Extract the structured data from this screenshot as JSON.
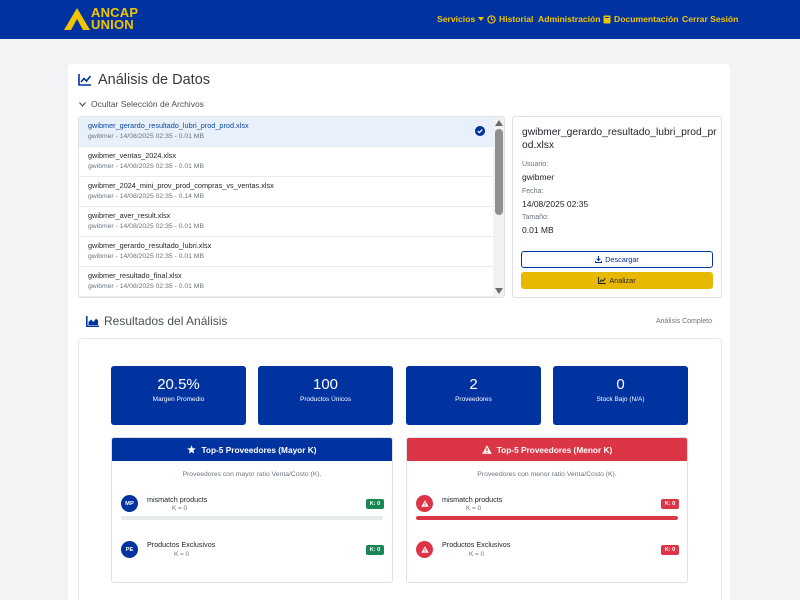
{
  "brand": {
    "line1": "ANCAP",
    "line2": "UNION"
  },
  "nav": {
    "servicios": "Servicios",
    "historial": "Historial",
    "administracion": "Administración",
    "documentacion": "Documentación",
    "cerrar": "Cerrar Sesión"
  },
  "page": {
    "title": "Análisis de Datos",
    "toggle_label": "Ocultar Selección de Archivos"
  },
  "files": [
    {
      "name": "gwibmer_gerardo_resultado_lubri_prod_prod.xlsx",
      "meta": "gwibmer - 14/08/2025 02:35 - 0.01 MB",
      "selected": true
    },
    {
      "name": "gwibmer_ventas_2024.xlsx",
      "meta": "gwibmer - 14/08/2025 02:35 - 0.01 MB",
      "selected": false
    },
    {
      "name": "gwibmer_2024_mini_prov_prod_compras_vs_ventas.xlsx",
      "meta": "gwibmer - 14/08/2025 02:35 - 0.14 MB",
      "selected": false
    },
    {
      "name": "gwibmer_aver_result.xlsx",
      "meta": "gwibmer - 14/08/2025 02:35 - 0.01 MB",
      "selected": false
    },
    {
      "name": "gwibmer_gerardo_resultado_lubri.xlsx",
      "meta": "gwibmer - 14/08/2025 02:35 - 0.01 MB",
      "selected": false
    },
    {
      "name": "gwibmer_resultado_final.xlsx",
      "meta": "gwibmer - 14/08/2025 02:35 - 0.01 MB",
      "selected": false
    }
  ],
  "details": {
    "title": "gwibmer_gerardo_resultado_lubri_prod_prod.xlsx",
    "user_label": "Usuario:",
    "user_value": "gwibmer",
    "date_label": "Fecha:",
    "date_value": "14/08/2025 02:35",
    "size_label": "Tamaño:",
    "size_value": "0.01 MB",
    "download_label": "Descargar",
    "analyze_label": "Analizar"
  },
  "results": {
    "title": "Resultados del Análisis",
    "status": "Análisis Completo",
    "metrics": [
      {
        "value": "20.5%",
        "label": "Margen Promedio"
      },
      {
        "value": "100",
        "label": "Productos Únicos"
      },
      {
        "value": "2",
        "label": "Proveedores"
      },
      {
        "value": "0",
        "label": "Stock Bajo (N/A)"
      }
    ],
    "top_major": {
      "title": "Top-5 Proveedores (Mayor K)",
      "subtitle": "Proveedores con mayor ratio Venta/Costo (K).",
      "color": "#0033a0",
      "items": [
        {
          "initials": "MP",
          "name": "mismatch products",
          "k_text": "K = 0",
          "badge": "K: 0",
          "fill_fraction": 0.0
        },
        {
          "initials": "PE",
          "name": "Productos Exclusivos",
          "k_text": "K = 0",
          "badge": "K: 0",
          "fill_fraction": 0.0
        }
      ]
    },
    "top_minor": {
      "title": "Top-5 Proveedores (Menor K)",
      "subtitle": "Proveedores con menor ratio Venta/Costo (K).",
      "color": "#dc3545",
      "items": [
        {
          "name": "mismatch products",
          "k_text": "K = 0",
          "badge": "K: 0",
          "fill_fraction": 1.0
        },
        {
          "name": "Productos Exclusivos",
          "k_text": "K = 0",
          "badge": "K: 0",
          "fill_fraction": 1.0
        }
      ]
    }
  },
  "colors": {
    "primary": "#0033a0",
    "accent": "#f2c400",
    "danger": "#dc3545",
    "success": "#198754"
  }
}
